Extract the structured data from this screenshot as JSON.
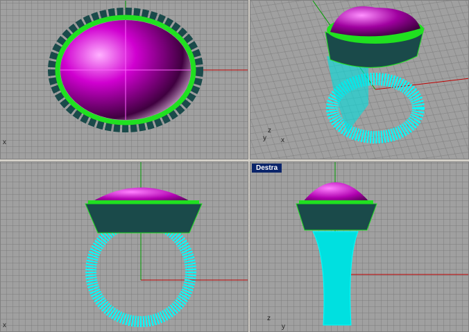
{
  "viewports": [
    {
      "id": "top",
      "label": "",
      "axes": [
        "x"
      ]
    },
    {
      "id": "perspective",
      "label": "",
      "axes": [
        "z",
        "y",
        "x"
      ]
    },
    {
      "id": "front",
      "label": "",
      "axes": [
        "x"
      ]
    },
    {
      "id": "right",
      "label": "Destra",
      "axes": [
        "z",
        "y"
      ]
    }
  ],
  "colors": {
    "gem": "#c000c0",
    "bezel": "#20e020",
    "shank": "#00ffff",
    "stones": "#1a5050",
    "x_axis": "#c00000",
    "y_axis": "#00a000",
    "grid_bg": "#a0a0a0",
    "label_bg": "#0a246a"
  }
}
